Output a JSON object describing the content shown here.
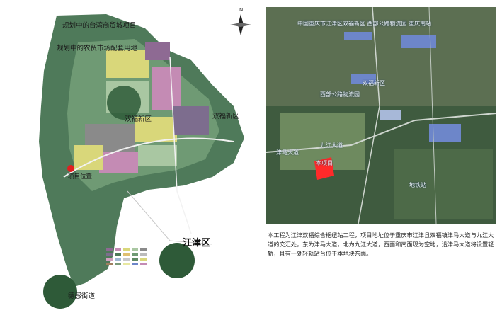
{
  "left_map": {
    "labels": {
      "taiwan": "规划中的台湾商贸城项目",
      "agri": "规划中的农贸市场配套用地",
      "shuangfu_center": "双福新区",
      "shuangfu_east": "双福新区",
      "project": "项目位置",
      "jiangjin": "江津区",
      "degan": "德感街道"
    },
    "colors": {
      "terrain_dark": "#4f7a5a",
      "terrain_mid": "#6f9a74",
      "terrain_light": "#a9c7a2",
      "urban_purple": "#8e6a93",
      "urban_pink": "#c48bb4",
      "urban_yellow": "#d9d77a",
      "district_circle": "#2e5a38",
      "marker": "#e02020"
    }
  },
  "right_map": {
    "labels": {
      "top": "中国重庆市江津区双福新区 西部公路物流园 重庆南站",
      "mid1": "双福新区",
      "mid2": "西部公路物流园",
      "road": "九江大道",
      "left": "津马大道",
      "project": "本项目",
      "right": "地铁站"
    },
    "colors": {
      "sat_base": "#3f5b3f",
      "sat_field": "#6e8a5f",
      "factory_blue": "#6d86c9",
      "project_red": "#ff2a2a"
    }
  },
  "description": "本工程为江津双福综合枢纽站工程，项目地址位于重庆市江津县双福镇津马大道与九江大道的交汇处，东为津马大道，北为九江大道，西面和南面现为空地，沿津马大道将设置轻轨，且有一处轻轨站台位于本地块东面。"
}
